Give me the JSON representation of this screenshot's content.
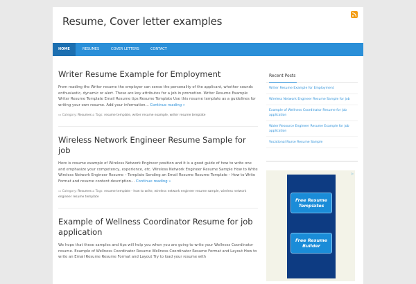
{
  "site": {
    "title": "Resume, Cover letter examples"
  },
  "nav": [
    {
      "label": "HOME",
      "active": true
    },
    {
      "label": "RESUMES",
      "active": false
    },
    {
      "label": "COVER LETTERS",
      "active": false
    },
    {
      "label": "CONTACT",
      "active": false
    }
  ],
  "posts": [
    {
      "title": "Writer Resume Example for Employment",
      "excerpt": "From reading the Writer resume the employer can sense the personality of the applicant, whether sounds enthusiastic, dynamic or alert. These are key attributes for a job in promotion. Writer Resume Example Writer Resume Template Email Resume tips Resume Template Use this resume template as a guidelines for writing your own resume. Add your information…",
      "more": "Continue reading »",
      "category_label": "Category:",
      "category": "Resumes",
      "tags_label": "Tags:",
      "tags": [
        "resume template",
        "writer resume example",
        "writer resume template"
      ]
    },
    {
      "title": "Wireless Network Engineer Resume Sample for job",
      "excerpt": "Here is resume example of Wireless Network Engineer position and it is a good guide of how to write one and emphasize your competency, experience, etc. Wireless Network Engineer Resume Sample How to Write Wireless Network Engineer Resume – Template Sending an Email Resume Resume Template – How to Write Format and resume content description…",
      "more": "Continue reading »",
      "category_label": "Category:",
      "category": "Resumes",
      "tags_label": "Tags:",
      "tags": [
        "resume template - how to write",
        "wireless network engineer resume sample",
        "wireless network engineer resume template"
      ]
    },
    {
      "title": "Example of Wellness Coordinator Resume for job application",
      "excerpt": "We hope that these samples and tips will help you when you are going to write your Wellness Coordinator resume. Example of Wellness Coordinator Resume Wellness Coordinator Resume Format and Layout How to write an Email Resume Resume Format and Layout Try to load your resume with"
    }
  ],
  "sidebar": {
    "widget_title": "Recent Posts",
    "recent": [
      "Writer Resume Example for Employment",
      "Wireless Network Engineer Resume Sample for job",
      "Example of Wellness Coordinator Resume for job application",
      "Water Resource Engineer Resume Example for job application",
      "Vocational Nurse Resume Sample"
    ],
    "ad": {
      "button1": "Free Resume Templates",
      "button2": "Free Resume Builder"
    }
  },
  "colors": {
    "accent": "#2a8fd8",
    "nav_active": "#1c6fb0",
    "rss": "#f39c12",
    "ad_bg": "#0d3b82"
  }
}
